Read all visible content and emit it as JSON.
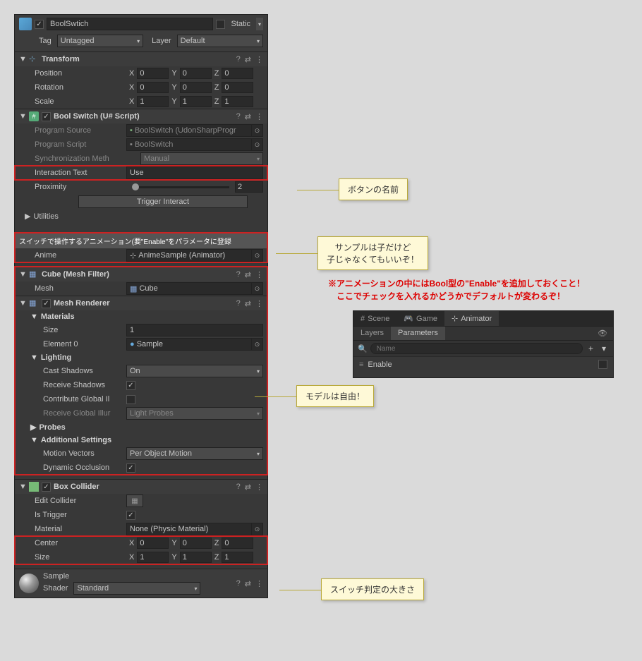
{
  "header": {
    "name": "BoolSwtich",
    "static_label": "Static",
    "tag_label": "Tag",
    "tag_value": "Untagged",
    "layer_label": "Layer",
    "layer_value": "Default"
  },
  "transform": {
    "title": "Transform",
    "position_label": "Position",
    "rotation_label": "Rotation",
    "scale_label": "Scale",
    "pos": {
      "x": "0",
      "y": "0",
      "z": "0"
    },
    "rot": {
      "x": "0",
      "y": "0",
      "z": "0"
    },
    "scale": {
      "x": "1",
      "y": "1",
      "z": "1"
    }
  },
  "script": {
    "title": "Bool Switch (U# Script)",
    "program_source_label": "Program Source",
    "program_source_value": "BoolSwitch (UdonSharpProgr",
    "program_script_label": "Program Script",
    "program_script_value": "BoolSwitch",
    "sync_label": "Synchronization Meth",
    "sync_value": "Manual",
    "interaction_label": "Interaction Text",
    "interaction_value": "Use",
    "proximity_label": "Proximity",
    "proximity_value": "2",
    "trigger_button": "Trigger Interact",
    "utilities_label": "Utilities",
    "anime_header": "スイッチで操作するアニメーション(要\"Enable\"をパラメータに登録",
    "anime_label": "Anime",
    "anime_value": "AnimeSample (Animator)"
  },
  "mesh_filter": {
    "title": "Cube (Mesh Filter)",
    "mesh_label": "Mesh",
    "mesh_value": "Cube"
  },
  "mesh_renderer": {
    "title": "Mesh Renderer",
    "materials_label": "Materials",
    "size_label": "Size",
    "size_value": "1",
    "element0_label": "Element 0",
    "element0_value": "Sample",
    "lighting_label": "Lighting",
    "cast_shadows_label": "Cast Shadows",
    "cast_shadows_value": "On",
    "receive_shadows_label": "Receive Shadows",
    "contribute_gi_label": "Contribute Global Il",
    "receive_gi_label": "Receive Global Illur",
    "receive_gi_value": "Light Probes",
    "probes_label": "Probes",
    "additional_label": "Additional Settings",
    "motion_vectors_label": "Motion Vectors",
    "motion_vectors_value": "Per Object Motion",
    "dynamic_occlusion_label": "Dynamic Occlusion"
  },
  "box_collider": {
    "title": "Box Collider",
    "edit_collider_label": "Edit Collider",
    "is_trigger_label": "Is Trigger",
    "material_label": "Material",
    "material_value": "None (Physic Material)",
    "center_label": "Center",
    "size_label": "Size",
    "center": {
      "x": "0",
      "y": "0",
      "z": "0"
    },
    "size": {
      "x": "1",
      "y": "1",
      "z": "1"
    }
  },
  "material": {
    "name": "Sample",
    "shader_label": "Shader",
    "shader_value": "Standard"
  },
  "callouts": {
    "button_name": "ボタンの名前",
    "sample_child": "サンプルは子だけど\n子じゃなくてもいいぞ！",
    "model_free": "モデルは自由！",
    "switch_size": "スイッチ判定の大きさ",
    "red_note": "※アニメーションの中にはBool型の\"Enable\"を追加しておくこと！\n　ここでチェックを入れるかどうかでデフォルトが変わるぞ！"
  },
  "animator": {
    "tab_scene": "Scene",
    "tab_game": "Game",
    "tab_animator": "Animator",
    "subtab_layers": "Layers",
    "subtab_parameters": "Parameters",
    "search_placeholder": "Name",
    "param_enable": "Enable"
  },
  "labels": {
    "x": "X",
    "y": "Y",
    "z": "Z"
  }
}
